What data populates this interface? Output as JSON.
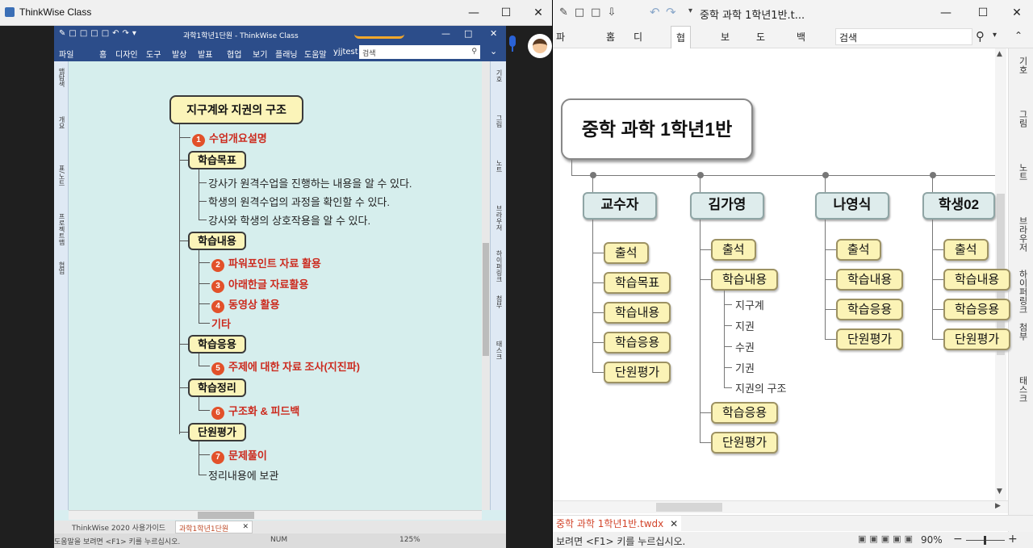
{
  "left_window": {
    "title": "ThinkWise Class",
    "inner": {
      "doc_title": "과학1학년1단원 - ThinkWise Class",
      "menu": [
        "파일",
        "홈",
        "디자인",
        "도구",
        "발상",
        "발표",
        "협업",
        "보기",
        "플래닝",
        "도움말",
        "yjjtest"
      ],
      "search_placeholder": "검색",
      "left_panel": [
        "맵탐색",
        "개요",
        "표/노트",
        "프로젝트맵",
        "협업"
      ],
      "right_panel": [
        "기호",
        "그림",
        "노트",
        "브라우저",
        "하이퍼링크",
        "첨부",
        "태스크"
      ],
      "tabs": [
        "ThinkWise 2020 사용가이드",
        "과학1학년1단원"
      ],
      "status": {
        "help": "도움말을 보려면 <F1> 키를 누르십시오.",
        "num": "NUM",
        "zoom": "125%"
      }
    },
    "map": {
      "root": "지구계와 지권의 구조",
      "items": [
        {
          "type": "red",
          "num": "1",
          "text": "수업개요설명"
        },
        {
          "type": "box",
          "text": "학습목표"
        },
        {
          "type": "text",
          "text": "강사가 원격수업을 진행하는 내용을 알 수 있다."
        },
        {
          "type": "text",
          "text": "학생의 원격수업의 과정을 확인할 수 있다."
        },
        {
          "type": "text",
          "text": "강사와 학생의 상호작용을 알 수 있다."
        },
        {
          "type": "box",
          "text": "학습내용"
        },
        {
          "type": "red",
          "num": "2",
          "text": "파워포인트 자료 활용"
        },
        {
          "type": "red",
          "num": "3",
          "text": "아래한글 자료활용"
        },
        {
          "type": "red",
          "num": "4",
          "text": "동영상 활용"
        },
        {
          "type": "red",
          "num": "",
          "text": "기타"
        },
        {
          "type": "box",
          "text": "학습응용"
        },
        {
          "type": "red",
          "num": "5",
          "text": "주제에 대한 자료 조사(지진파)"
        },
        {
          "type": "box",
          "text": "학습정리"
        },
        {
          "type": "red",
          "num": "6",
          "text": "구조화 & 피드백"
        },
        {
          "type": "box",
          "text": "단원평가"
        },
        {
          "type": "red",
          "num": "7",
          "text": "문제풀이"
        },
        {
          "type": "text",
          "text": "정리내용에 보관"
        }
      ]
    }
  },
  "right_window": {
    "title": "중학 과학 1학년1반.t...",
    "menu": [
      "파일",
      "홈",
      "디자인",
      "협업",
      "보기",
      "도움말",
      "백주희"
    ],
    "active_menu": "협업",
    "search_placeholder": "검색",
    "sidebar": [
      "기호",
      "그림",
      "노트",
      "브라우저",
      "하이퍼링크",
      "첨부",
      "태스크"
    ],
    "tab": "중학 과학 1학년1반.twdx",
    "status": {
      "help": "보려면 <F1> 키를 누르십시오.",
      "zoom": "90%"
    },
    "map": {
      "root": "중학 과학 1학년1반",
      "columns": [
        {
          "name": "교수자",
          "children": [
            "출석",
            "학습목표",
            "학습내용",
            "학습응용",
            "단원평가"
          ]
        },
        {
          "name": "김가영",
          "children": [
            "출석",
            "학습내용",
            "학습응용",
            "단원평가"
          ],
          "sub": [
            "지구계",
            "지권",
            "수권",
            "기권",
            "지권의 구조"
          ]
        },
        {
          "name": "나영식",
          "children": [
            "출석",
            "학습내용",
            "학습응용",
            "단원평가"
          ]
        },
        {
          "name": "학생02",
          "children": [
            "출석",
            "학습내용",
            "학습응용",
            "단원평가"
          ]
        }
      ]
    }
  }
}
